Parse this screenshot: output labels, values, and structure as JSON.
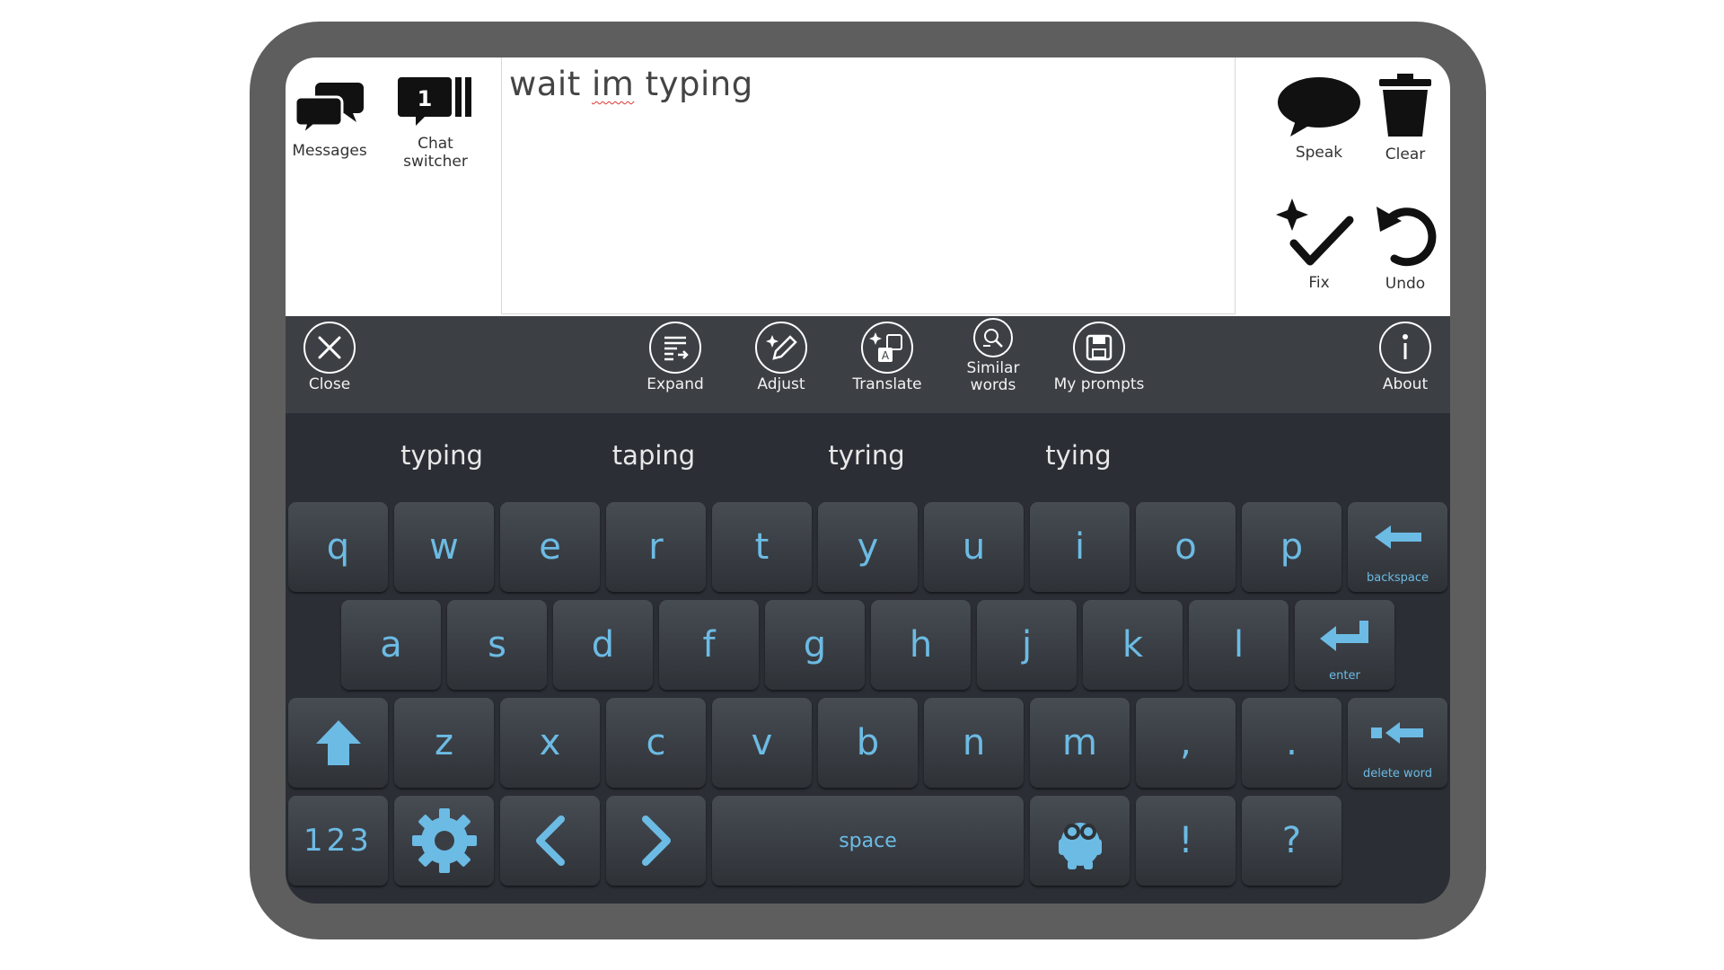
{
  "top": {
    "messages_label": "Messages",
    "chat_switcher_label": "Chat\nswitcher",
    "chat_switcher_count": "1",
    "speak_label": "Speak",
    "clear_label": "Clear",
    "fix_label": "Fix",
    "undo_label": "Undo"
  },
  "text_area": {
    "before": "wait ",
    "misspelled": "im",
    "after": " typing"
  },
  "toolbar": {
    "close": "Close",
    "expand": "Expand",
    "adjust": "Adjust",
    "translate": "Translate",
    "similar": "Similar\nwords",
    "prompts": "My prompts",
    "about": "About"
  },
  "suggestions": [
    "typing",
    "taping",
    "tyring",
    "tying"
  ],
  "keyboard": {
    "row1": [
      "q",
      "w",
      "e",
      "r",
      "t",
      "y",
      "u",
      "i",
      "o",
      "p"
    ],
    "row2": [
      "a",
      "s",
      "d",
      "f",
      "g",
      "h",
      "j",
      "k",
      "l"
    ],
    "row3": [
      "z",
      "x",
      "c",
      "v",
      "b",
      "n",
      "m",
      ",",
      "."
    ],
    "backspace": "backspace",
    "enter": "enter",
    "delete_word": "delete word",
    "numbers": "123",
    "space": "space",
    "exclaim": "!",
    "question": "?"
  },
  "colors": {
    "key_text": "#6cbbe4",
    "toolbar_bg": "#3c4045",
    "keyboard_bg": "#2b2f35"
  }
}
